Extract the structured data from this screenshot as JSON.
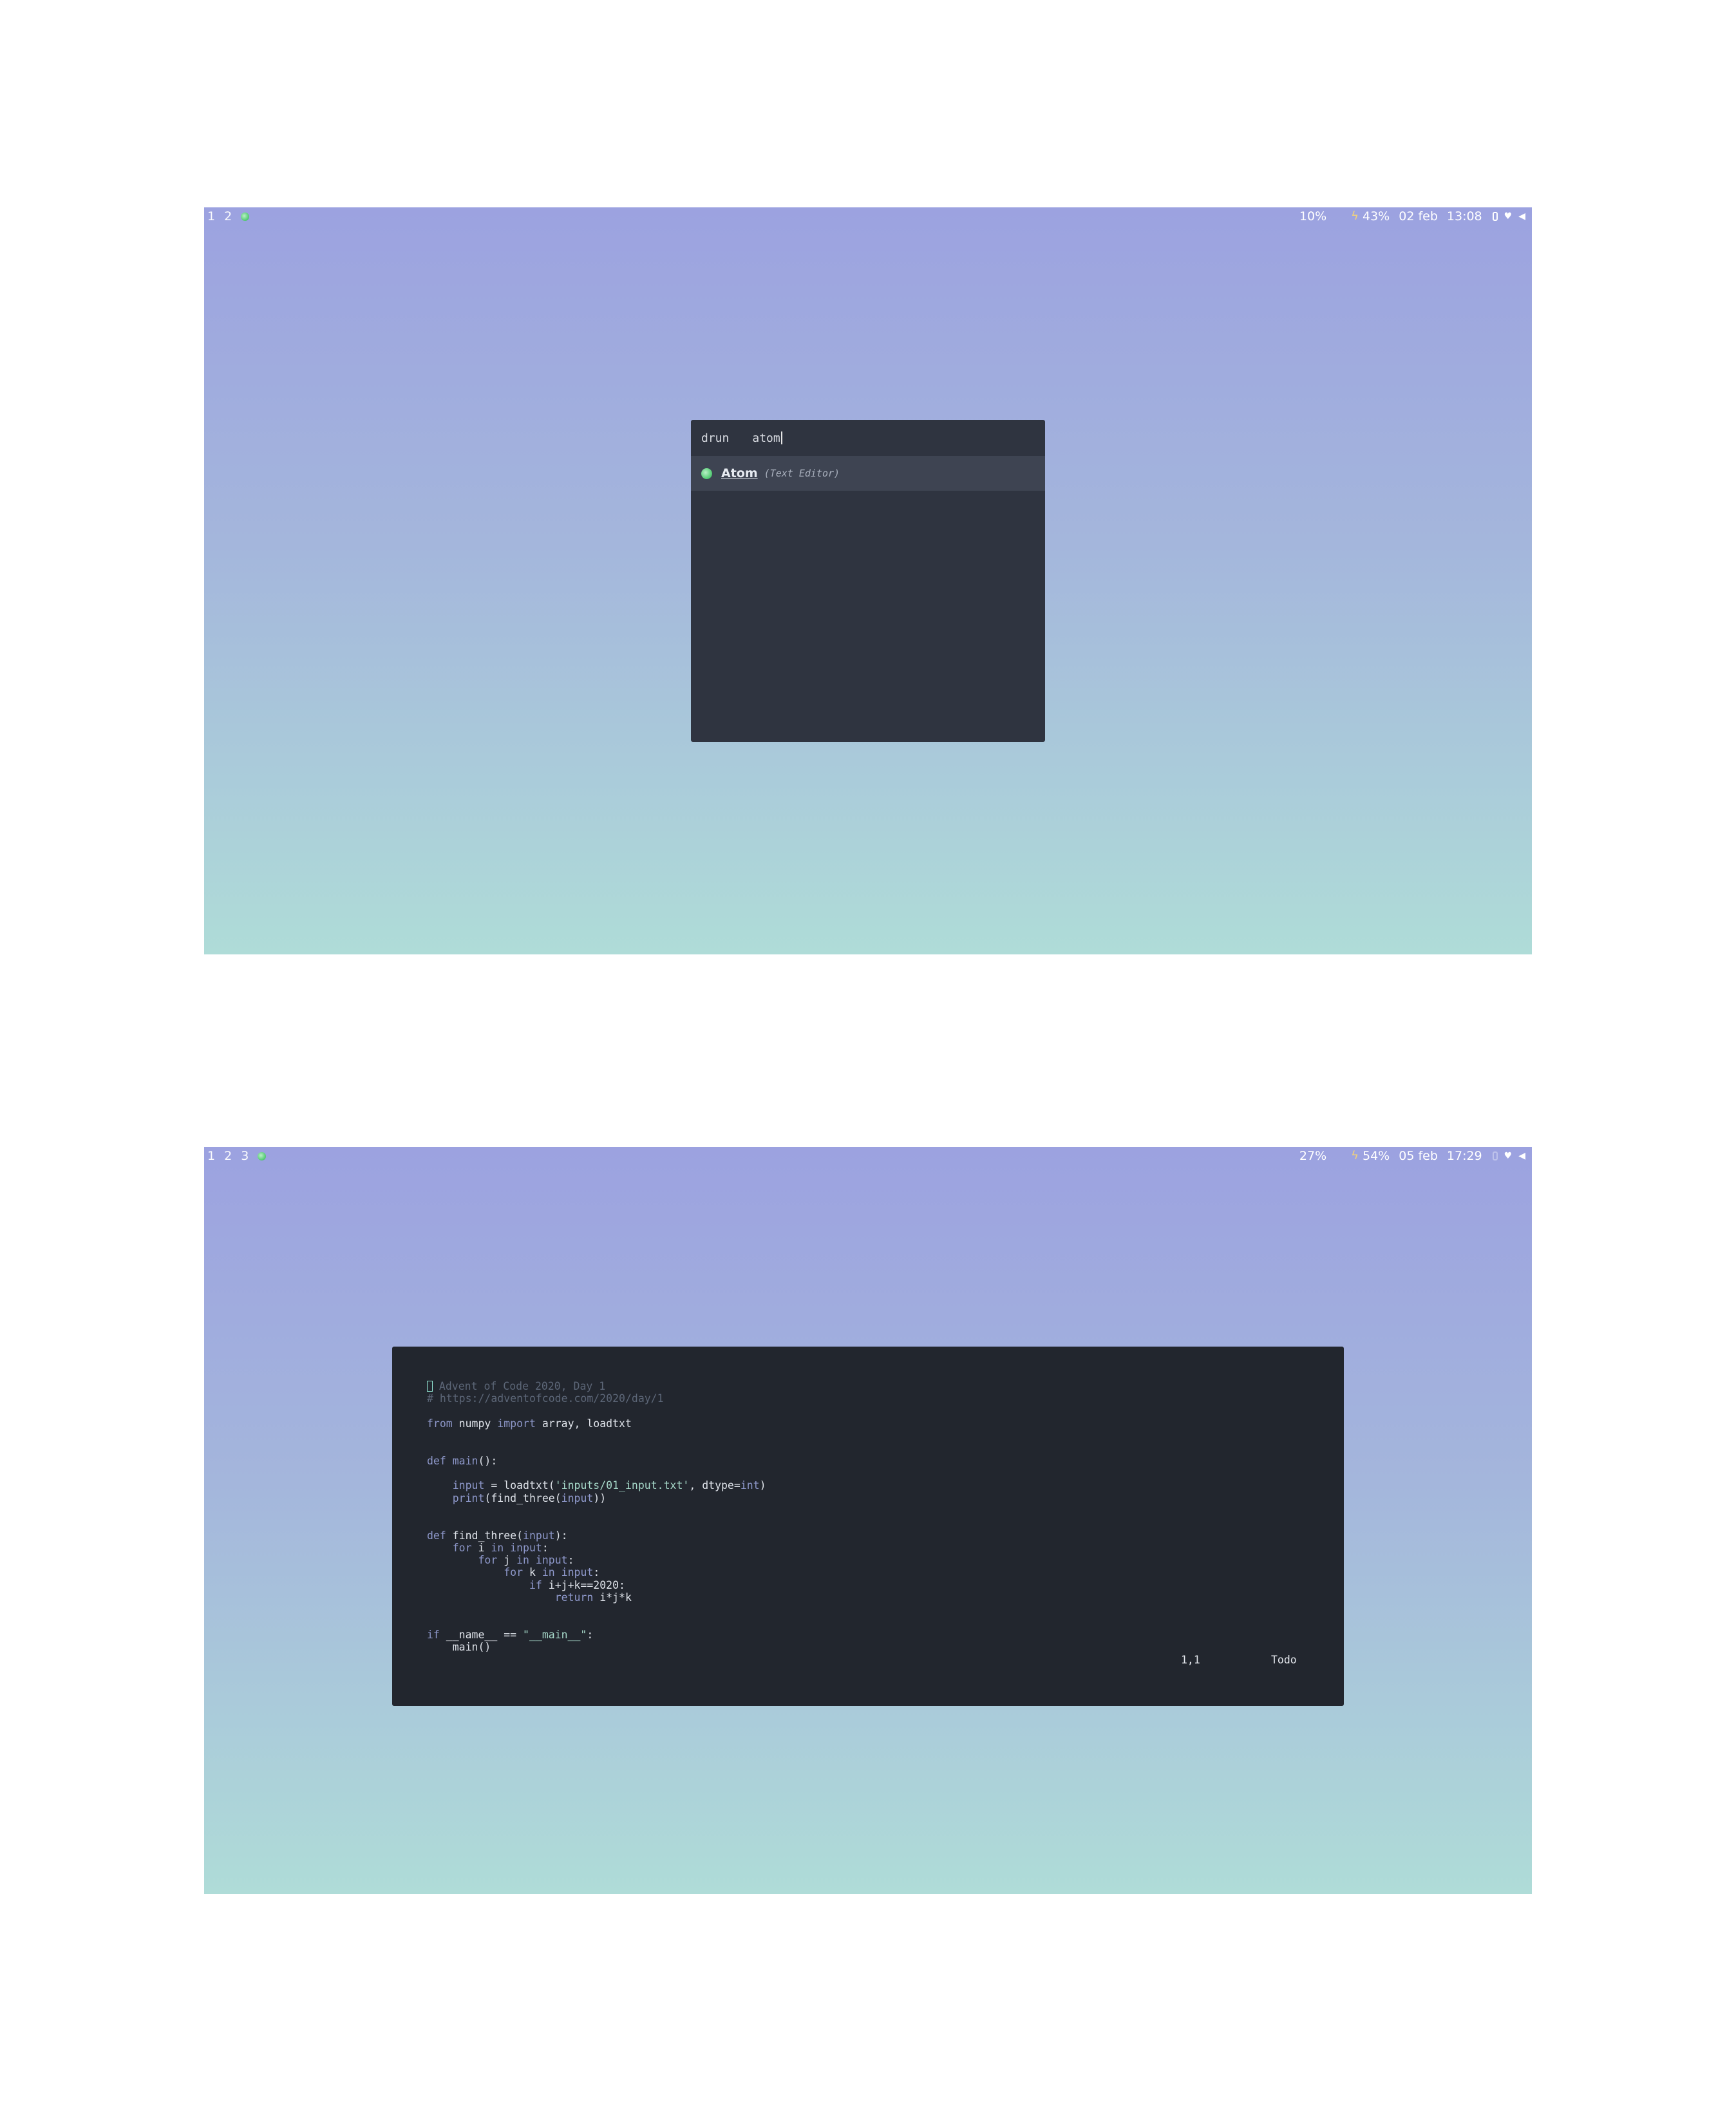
{
  "screen1": {
    "bar": {
      "workspaces": [
        "1",
        "2"
      ],
      "cpu": "10%",
      "battery": "43%",
      "date": "02 feb",
      "time": "13:08"
    },
    "launcher": {
      "mode": "drun",
      "query": "atom",
      "results": [
        {
          "name": "Atom",
          "description": "(Text Editor)"
        }
      ]
    }
  },
  "screen2": {
    "bar": {
      "workspaces": [
        "1",
        "2",
        "3"
      ],
      "cpu": "27%",
      "battery": "54%",
      "date": "05 feb",
      "time": "17:29"
    },
    "editor": {
      "code": {
        "l1_comment": " Advent of Code 2020, Day 1",
        "l2_comment": "# https://adventofcode.com/2020/day/1",
        "l4_from": "from",
        "l4_mod": " numpy ",
        "l4_import": "import",
        "l4_names": " array, loadtxt",
        "l7_def": "def",
        "l7_name": " main",
        "l7_rest": "():",
        "l9_indent": "    ",
        "l9_input": "input",
        "l9_mid": " = loadtxt(",
        "l9_str": "'inputs/01_input.txt'",
        "l9_mid2": ", dtype=",
        "l9_int": "int",
        "l9_end": ")",
        "l10_print": "print",
        "l10_mid": "(find_three(",
        "l10_input": "input",
        "l10_end": "))",
        "l13_def": "def",
        "l13_name": " find_three(",
        "l13_input": "input",
        "l13_end": "):",
        "l14_for": "for",
        "l14_i": " i ",
        "l14_in": "in",
        "l14_input": " input",
        "l14_end": ":",
        "l15_for": "for",
        "l15_j": " j ",
        "l15_in": "in",
        "l15_input": " input",
        "l15_end": ":",
        "l16_for": "for",
        "l16_k": " k ",
        "l16_in": "in",
        "l16_input": " input",
        "l16_end": ":",
        "l17_if": "if",
        "l17_cond": " i+j+k==2020:",
        "l18_return": "return",
        "l18_expr": " i*j*k",
        "l21_if": "if",
        "l21_name": " __name__ == ",
        "l21_str": "\"__main__\"",
        "l21_end": ":",
        "l22_call": "main()"
      },
      "position": "1,1",
      "scroll": "Todo"
    }
  }
}
